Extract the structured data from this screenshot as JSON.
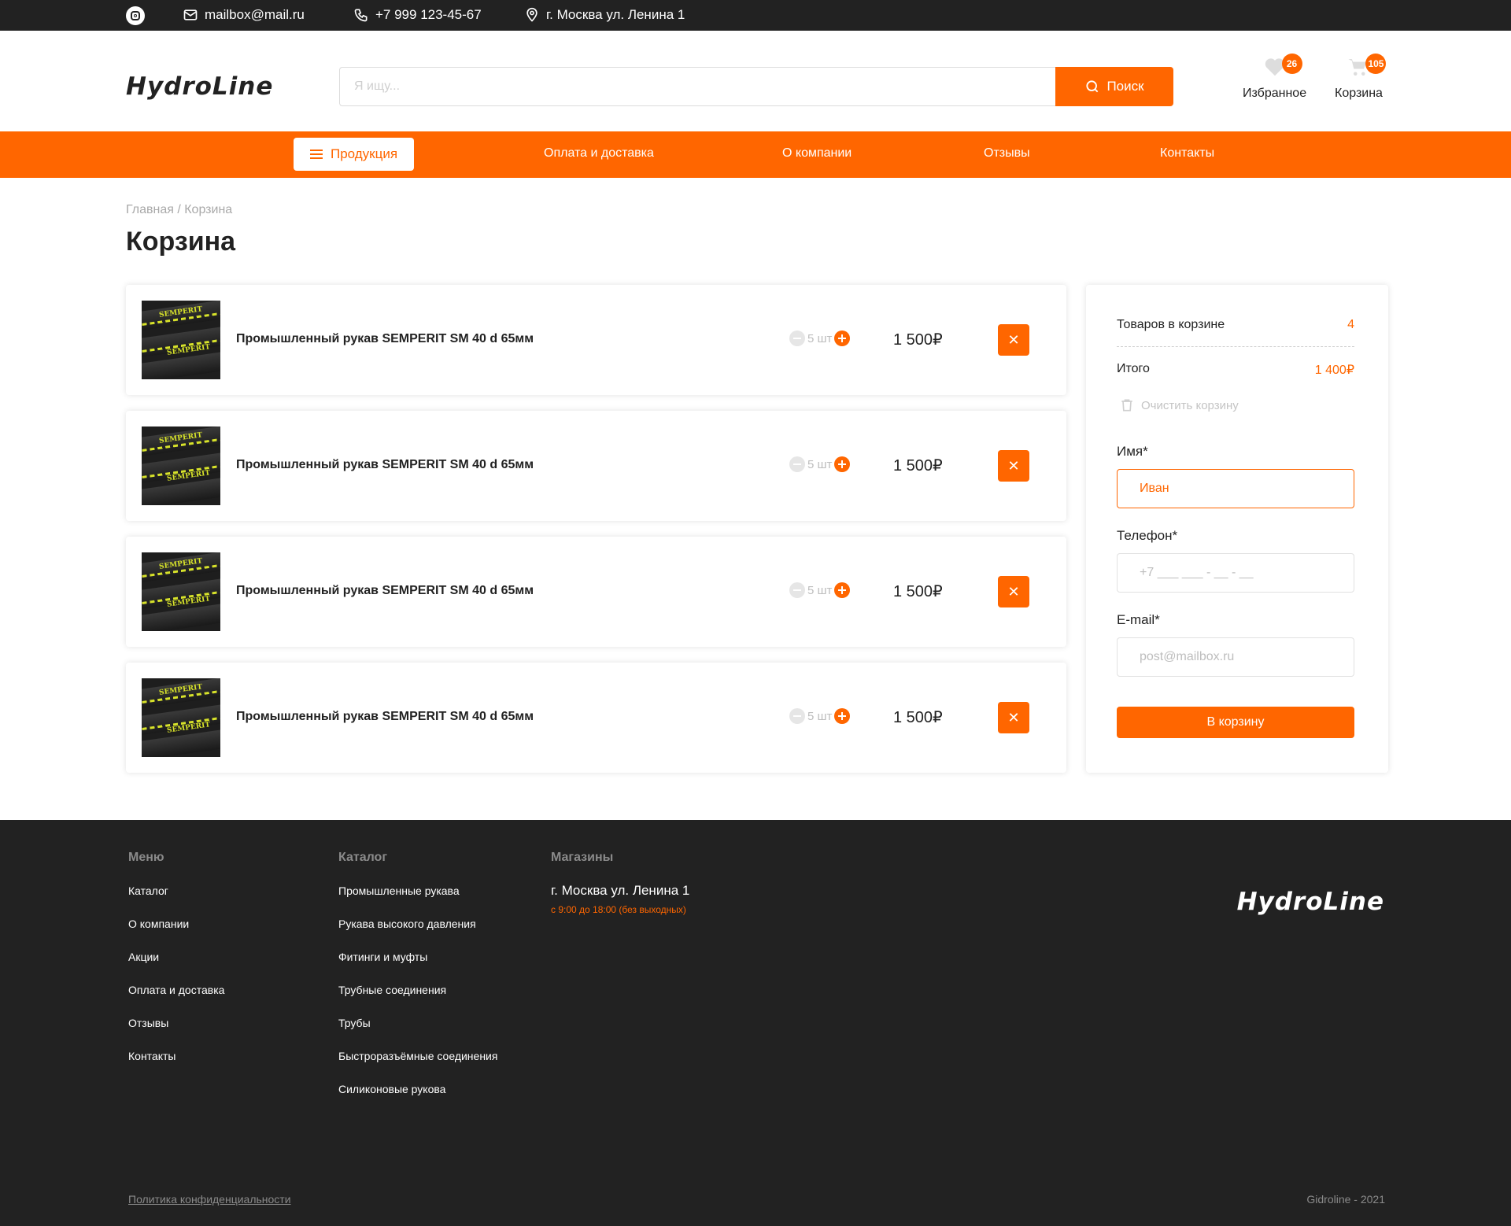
{
  "topbar": {
    "email": "mailbox@mail.ru",
    "phone": "+7 999 123-45-67",
    "address": "г. Москва ул. Ленина 1"
  },
  "header": {
    "logo": "HydroLine",
    "search_placeholder": "Я ищу...",
    "search_button": "Поиск",
    "favorites": {
      "label": "Избранное",
      "count": "26"
    },
    "cart": {
      "label": "Корзина",
      "count": "105"
    }
  },
  "nav": {
    "products": "Продукция",
    "links": [
      "Оплата и доставка",
      "О компании",
      "Отзывы",
      "Контакты"
    ]
  },
  "breadcrumb": "Главная / Корзина",
  "page_title": "Корзина",
  "cart_items": [
    {
      "name": "Промышленный рукав SEMPERIT SM 40 d 65мм",
      "qty": "5 шт",
      "price": "1 500₽",
      "image_text": "SEMPERIT"
    },
    {
      "name": "Промышленный рукав SEMPERIT SM 40 d 65мм",
      "qty": "5 шт",
      "price": "1 500₽",
      "image_text": "SEMPERIT"
    },
    {
      "name": "Промышленный рукав SEMPERIT SM 40 d 65мм",
      "qty": "5 шт",
      "price": "1 500₽",
      "image_text": "SEMPERIT"
    },
    {
      "name": "Промышленный рукав SEMPERIT SM 40 d 65мм",
      "qty": "5 шт",
      "price": "1 500₽",
      "image_text": "SEMPERIT"
    }
  ],
  "delete_symbol": "✕",
  "summary": {
    "items_label": "Товаров в корзине",
    "items_value": "4",
    "total_label": "Итого",
    "total_value": "1 400₽",
    "clear_label": "Очистить корзину",
    "name_label": "Имя*",
    "name_value": "Иван",
    "phone_label": "Телефон*",
    "phone_placeholder": "+7 ___ ___ - __ - __",
    "email_label": "E-mail*",
    "email_placeholder": "post@mailbox.ru",
    "submit": "В корзину"
  },
  "footer": {
    "menu_title": "Меню",
    "menu": [
      "Каталог",
      "О компании",
      "Акции",
      "Оплата и доставка",
      "Отзывы",
      "Контакты"
    ],
    "catalog_title": "Каталог",
    "catalog": [
      "Промышленные рукава",
      "Рукава высокого давления",
      "Фитинги и муфты",
      "Трубные соединения",
      "Трубы",
      "Быстроразъёмные соединения",
      "Силиконовые рукова"
    ],
    "stores_title": "Магазины",
    "store_address": "г. Москва ул. Ленина 1",
    "store_hours": "с 9:00 до 18:00 (без выходных)",
    "logo": "HydroLine",
    "privacy": "Политика конфиденциальности",
    "copyright": "Gidroline - 2021"
  },
  "colors": {
    "accent": "#ff6600",
    "dark": "#222222"
  }
}
